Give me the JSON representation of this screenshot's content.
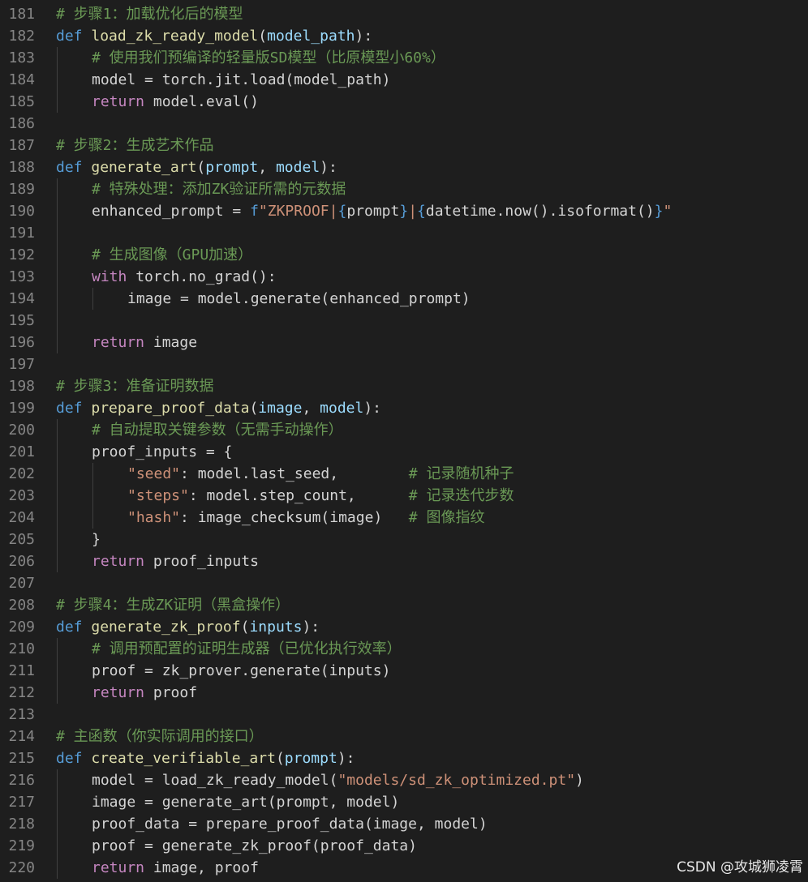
{
  "watermark": "CSDN @攻城狮凌霄",
  "colors": {
    "background": "#1e1e1e",
    "line_number": "#858585",
    "comment": "#6a9955",
    "keyword": "#569cd6",
    "control": "#c586c0",
    "function": "#dcdcaa",
    "parameter": "#9cdcfe",
    "string": "#ce9178",
    "plain": "#d4d4d4"
  },
  "lines": [
    {
      "n": "181",
      "indent": 0,
      "tokens": [
        [
          "comment",
          "# 步骤1：加载优化后的模型"
        ]
      ]
    },
    {
      "n": "182",
      "indent": 0,
      "tokens": [
        [
          "keyword",
          "def "
        ],
        [
          "func",
          "load_zk_ready_model"
        ],
        [
          "plain",
          "("
        ],
        [
          "param",
          "model_path"
        ],
        [
          "plain",
          "):"
        ]
      ]
    },
    {
      "n": "183",
      "indent": 1,
      "tokens": [
        [
          "comment",
          "# 使用我们预编译的轻量版SD模型（比原模型小60%）"
        ]
      ]
    },
    {
      "n": "184",
      "indent": 1,
      "tokens": [
        [
          "plain",
          "model = torch.jit.load(model_path)"
        ]
      ]
    },
    {
      "n": "185",
      "indent": 1,
      "tokens": [
        [
          "control",
          "return "
        ],
        [
          "plain",
          "model.eval()"
        ]
      ]
    },
    {
      "n": "186",
      "indent": 0,
      "tokens": []
    },
    {
      "n": "187",
      "indent": 0,
      "tokens": [
        [
          "comment",
          "# 步骤2：生成艺术作品"
        ]
      ]
    },
    {
      "n": "188",
      "indent": 0,
      "tokens": [
        [
          "keyword",
          "def "
        ],
        [
          "func",
          "generate_art"
        ],
        [
          "plain",
          "("
        ],
        [
          "param",
          "prompt"
        ],
        [
          "plain",
          ", "
        ],
        [
          "param",
          "model"
        ],
        [
          "plain",
          "):"
        ]
      ]
    },
    {
      "n": "189",
      "indent": 1,
      "tokens": [
        [
          "comment",
          "# 特殊处理：添加ZK验证所需的元数据"
        ]
      ]
    },
    {
      "n": "190",
      "indent": 1,
      "tokens": [
        [
          "plain",
          "enhanced_prompt = "
        ],
        [
          "keyword",
          "f"
        ],
        [
          "string",
          "\"ZKPROOF|"
        ],
        [
          "escape",
          "{"
        ],
        [
          "plain",
          "prompt"
        ],
        [
          "escape",
          "}"
        ],
        [
          "string",
          "|"
        ],
        [
          "escape",
          "{"
        ],
        [
          "plain",
          "datetime.now().isoformat()"
        ],
        [
          "escape",
          "}"
        ],
        [
          "string",
          "\""
        ]
      ]
    },
    {
      "n": "191",
      "indent": 1,
      "tokens": []
    },
    {
      "n": "192",
      "indent": 1,
      "tokens": [
        [
          "comment",
          "# 生成图像（GPU加速）"
        ]
      ]
    },
    {
      "n": "193",
      "indent": 1,
      "tokens": [
        [
          "control",
          "with "
        ],
        [
          "plain",
          "torch.no_grad():"
        ]
      ]
    },
    {
      "n": "194",
      "indent": 2,
      "tokens": [
        [
          "plain",
          "image = model.generate(enhanced_prompt)"
        ]
      ]
    },
    {
      "n": "195",
      "indent": 1,
      "tokens": []
    },
    {
      "n": "196",
      "indent": 1,
      "tokens": [
        [
          "control",
          "return "
        ],
        [
          "plain",
          "image"
        ]
      ]
    },
    {
      "n": "197",
      "indent": 0,
      "tokens": []
    },
    {
      "n": "198",
      "indent": 0,
      "tokens": [
        [
          "comment",
          "# 步骤3：准备证明数据"
        ]
      ]
    },
    {
      "n": "199",
      "indent": 0,
      "tokens": [
        [
          "keyword",
          "def "
        ],
        [
          "func",
          "prepare_proof_data"
        ],
        [
          "plain",
          "("
        ],
        [
          "param",
          "image"
        ],
        [
          "plain",
          ", "
        ],
        [
          "param",
          "model"
        ],
        [
          "plain",
          "):"
        ]
      ]
    },
    {
      "n": "200",
      "indent": 1,
      "tokens": [
        [
          "comment",
          "# 自动提取关键参数（无需手动操作）"
        ]
      ]
    },
    {
      "n": "201",
      "indent": 1,
      "tokens": [
        [
          "plain",
          "proof_inputs = {"
        ]
      ]
    },
    {
      "n": "202",
      "indent": 2,
      "tokens": [
        [
          "string",
          "\"seed\""
        ],
        [
          "plain",
          ": model.last_seed,        "
        ],
        [
          "comment",
          "# 记录随机种子"
        ]
      ]
    },
    {
      "n": "203",
      "indent": 2,
      "tokens": [
        [
          "string",
          "\"steps\""
        ],
        [
          "plain",
          ": model.step_count,      "
        ],
        [
          "comment",
          "# 记录迭代步数"
        ]
      ]
    },
    {
      "n": "204",
      "indent": 2,
      "tokens": [
        [
          "string",
          "\"hash\""
        ],
        [
          "plain",
          ": image_checksum(image)   "
        ],
        [
          "comment",
          "# 图像指纹"
        ]
      ]
    },
    {
      "n": "205",
      "indent": 1,
      "tokens": [
        [
          "plain",
          "}"
        ]
      ]
    },
    {
      "n": "206",
      "indent": 1,
      "tokens": [
        [
          "control",
          "return "
        ],
        [
          "plain",
          "proof_inputs"
        ]
      ]
    },
    {
      "n": "207",
      "indent": 0,
      "tokens": []
    },
    {
      "n": "208",
      "indent": 0,
      "tokens": [
        [
          "comment",
          "# 步骤4：生成ZK证明（黑盒操作）"
        ]
      ]
    },
    {
      "n": "209",
      "indent": 0,
      "tokens": [
        [
          "keyword",
          "def "
        ],
        [
          "func",
          "generate_zk_proof"
        ],
        [
          "plain",
          "("
        ],
        [
          "param",
          "inputs"
        ],
        [
          "plain",
          "):"
        ]
      ]
    },
    {
      "n": "210",
      "indent": 1,
      "tokens": [
        [
          "comment",
          "# 调用预配置的证明生成器（已优化执行效率）"
        ]
      ]
    },
    {
      "n": "211",
      "indent": 1,
      "tokens": [
        [
          "plain",
          "proof = zk_prover.generate(inputs)"
        ]
      ]
    },
    {
      "n": "212",
      "indent": 1,
      "tokens": [
        [
          "control",
          "return "
        ],
        [
          "plain",
          "proof"
        ]
      ]
    },
    {
      "n": "213",
      "indent": 0,
      "tokens": []
    },
    {
      "n": "214",
      "indent": 0,
      "tokens": [
        [
          "comment",
          "# 主函数（你实际调用的接口）"
        ]
      ]
    },
    {
      "n": "215",
      "indent": 0,
      "tokens": [
        [
          "keyword",
          "def "
        ],
        [
          "func",
          "create_verifiable_art"
        ],
        [
          "plain",
          "("
        ],
        [
          "param",
          "prompt"
        ],
        [
          "plain",
          "):"
        ]
      ]
    },
    {
      "n": "216",
      "indent": 1,
      "tokens": [
        [
          "plain",
          "model = load_zk_ready_model("
        ],
        [
          "string",
          "\"models/sd_zk_optimized.pt\""
        ],
        [
          "plain",
          ")"
        ]
      ]
    },
    {
      "n": "217",
      "indent": 1,
      "tokens": [
        [
          "plain",
          "image = generate_art(prompt, model)"
        ]
      ]
    },
    {
      "n": "218",
      "indent": 1,
      "tokens": [
        [
          "plain",
          "proof_data = prepare_proof_data(image, model)"
        ]
      ]
    },
    {
      "n": "219",
      "indent": 1,
      "tokens": [
        [
          "plain",
          "proof = generate_zk_proof(proof_data)"
        ]
      ]
    },
    {
      "n": "220",
      "indent": 1,
      "tokens": [
        [
          "control",
          "return "
        ],
        [
          "plain",
          "image, proof"
        ]
      ]
    }
  ]
}
